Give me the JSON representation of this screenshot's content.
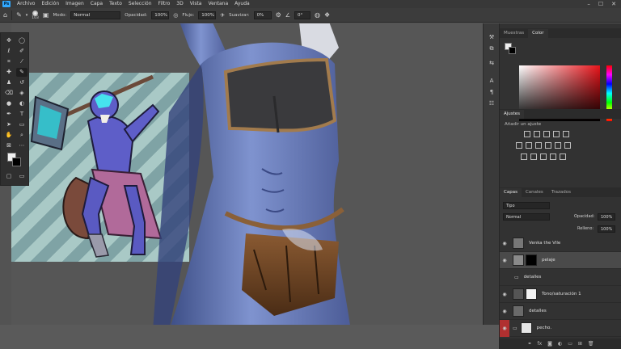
{
  "app": {
    "logo_text": "Ps"
  },
  "menu": [
    "Archivo",
    "Edición",
    "Imagen",
    "Capa",
    "Texto",
    "Selección",
    "Filtro",
    "3D",
    "Vista",
    "Ventana",
    "Ayuda"
  ],
  "options": {
    "brush_size": "103",
    "mode_label": "Modo:",
    "mode_value": "Normal",
    "opacity_label": "Opacidad:",
    "opacity_value": "100%",
    "flow_label": "Flujo:",
    "flow_value": "100%",
    "smooth_label": "Suavizar:",
    "smooth_value": "0%",
    "angle_value": "0°"
  },
  "panels": {
    "color_tabs": [
      "Muestras",
      "Color"
    ],
    "adjust_title": "Ajustes",
    "adjust_hint": "Añadir un ajuste",
    "layers_tabs": [
      "Capas",
      "Canales",
      "Trazados"
    ],
    "filter_value": "Tipo",
    "blend_value": "Normal",
    "opacity_label": "Opacidad:",
    "opacity_value": "100%",
    "fill_label": "Relleno:",
    "fill_value": "100%",
    "layers": [
      {
        "name": "Venka the Vile"
      },
      {
        "name": "pelaje"
      },
      {
        "name": "detalles"
      },
      {
        "name": "Tono/saturación 1"
      },
      {
        "name": "detalles"
      },
      {
        "name": "pecho."
      }
    ]
  },
  "colors": {
    "accent": "#31a8ff",
    "menu_bg": "#383838",
    "panel_bg": "#323232",
    "canvas_bg": "#565656"
  }
}
